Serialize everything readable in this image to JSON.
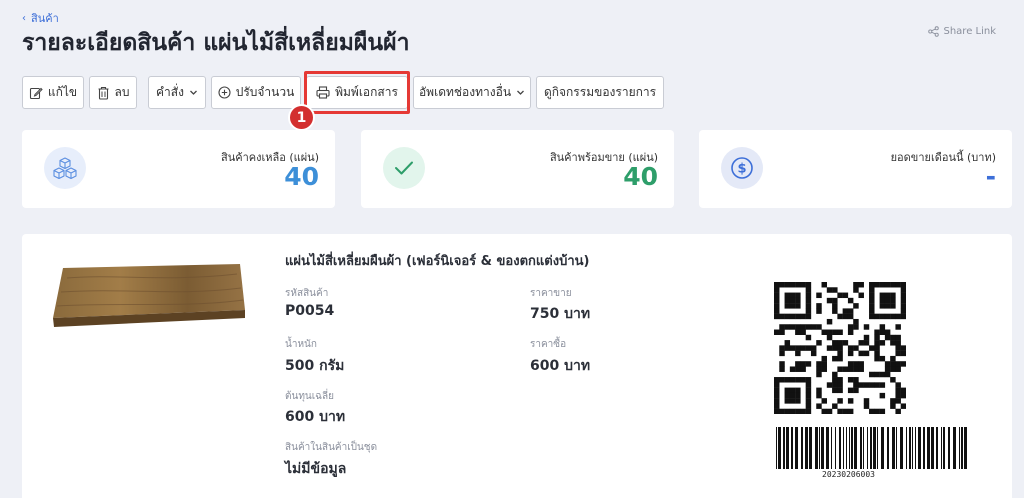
{
  "breadcrumb": {
    "label": "สินค้า"
  },
  "page": {
    "title": "รายละเอียดสินค้า แผ่นไม้สี่เหลี่ยมผืนผ้า",
    "share_label": "Share Link"
  },
  "toolbar": {
    "edit": "แก้ไข",
    "delete": "ลบ",
    "command": "คำสั่ง",
    "adjust": "ปรับจำนวน",
    "print": "พิมพ์เอกสาร",
    "update_channels": "อัพเดทช่องทางอื่น",
    "activity": "ดูกิจกรรมของรายการ"
  },
  "annotation": {
    "marker": "1",
    "color": "#e53935"
  },
  "stats": [
    {
      "label": "สินค้าคงเหลือ (แผ่น)",
      "value": "40",
      "color": "#3d8fd8",
      "icon": "boxes-icon"
    },
    {
      "label": "สินค้าพร้อมขาย (แผ่น)",
      "value": "40",
      "color": "#2e9e6a",
      "icon": "check-icon"
    },
    {
      "label": "ยอดขายเดือนนี้ (บาท)",
      "value": "-",
      "color": "#3d6fd8",
      "icon": "dollar-icon"
    }
  ],
  "product": {
    "name": "แผ่นไม้สี่เหลี่ยมผืนผ้า (เฟอร์นิเจอร์ & ของตกแต่งบ้าน)",
    "sku_label": "รหัสสินค้า",
    "sku": "P0054",
    "weight_label": "น้ำหนัก",
    "weight": "500 กรัม",
    "avg_cost_label": "ต้นทุนเฉลี่ย",
    "avg_cost": "600 บาท",
    "bundle_label": "สินค้าในสินค้าเป็นชุด",
    "bundle": "ไม่มีข้อมูล",
    "price_label": "ราคาขาย",
    "price": "750 บาท",
    "cost_label": "ราคาซื้อ",
    "cost": "600 บาท",
    "barcode": "20230206003"
  }
}
